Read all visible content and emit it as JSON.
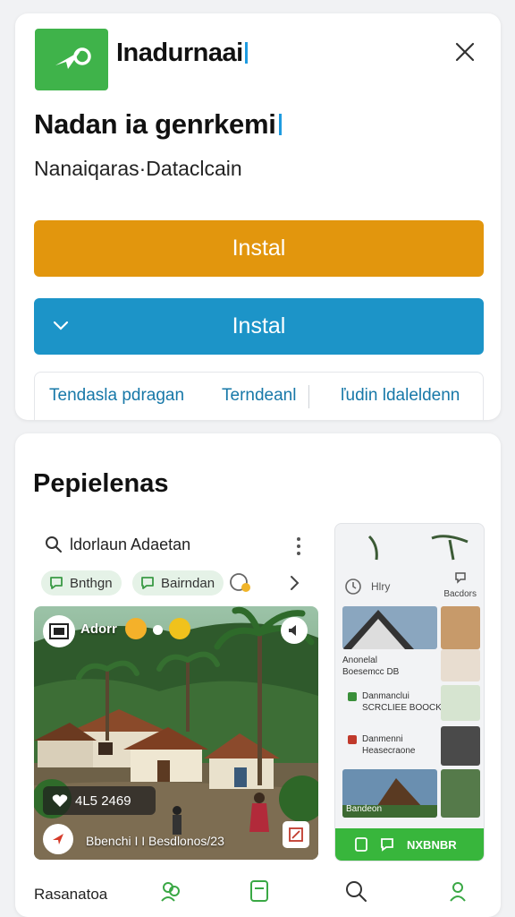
{
  "header": {
    "app_name": "Inadurnaai",
    "headline": "Nadan ia genrkemi",
    "subhead": "Nanaiqaras·Dataclcain"
  },
  "buttons": {
    "install_primary": "Instal",
    "install_secondary": "Instal"
  },
  "links": [
    "Tendasla pdragan",
    "Terndeanl",
    "ľudin ldaleldenn"
  ],
  "section": {
    "title": "Pepielenas"
  },
  "search": {
    "text": "ldorlaun Adaetan"
  },
  "chips": [
    "Bnthgn",
    "Bairndan"
  ],
  "photo": {
    "label": "Adorr",
    "stats": "4L5 2469",
    "caption": "Bbenchi I I Besdlonos/23"
  },
  "side_panel": {
    "row1": "Hlry",
    "right1": "Bacdors",
    "item1_line1": "Anonelal",
    "item1_line2": "Boesemcc DB",
    "item2_line1": "Danmanclui",
    "item2_line2": "SCRCLIEE BOOCK",
    "item3_line1": "Danmenni",
    "item3_line2": "Heasecraone",
    "item4_line1": "Bandeon",
    "green_button": "NXBNBR"
  },
  "bottom_nav": {
    "label": "Rasanatoa"
  },
  "colors": {
    "brand_green": "#3fb34a",
    "install_orange": "#e2960d",
    "install_blue": "#1c94c8",
    "link_blue": "#1778a8",
    "nav_green": "#38b63c"
  },
  "icons": [
    "paper-plane-icon",
    "close-icon",
    "chevron-down-icon",
    "search-icon",
    "more-vertical-icon",
    "chat-bubble-icon",
    "emoji-icon",
    "chevron-right-icon",
    "speaker-icon",
    "heart-icon",
    "expand-icon",
    "clock-icon",
    "user-icon",
    "people-icon",
    "tablet-icon",
    "profile-icon"
  ]
}
